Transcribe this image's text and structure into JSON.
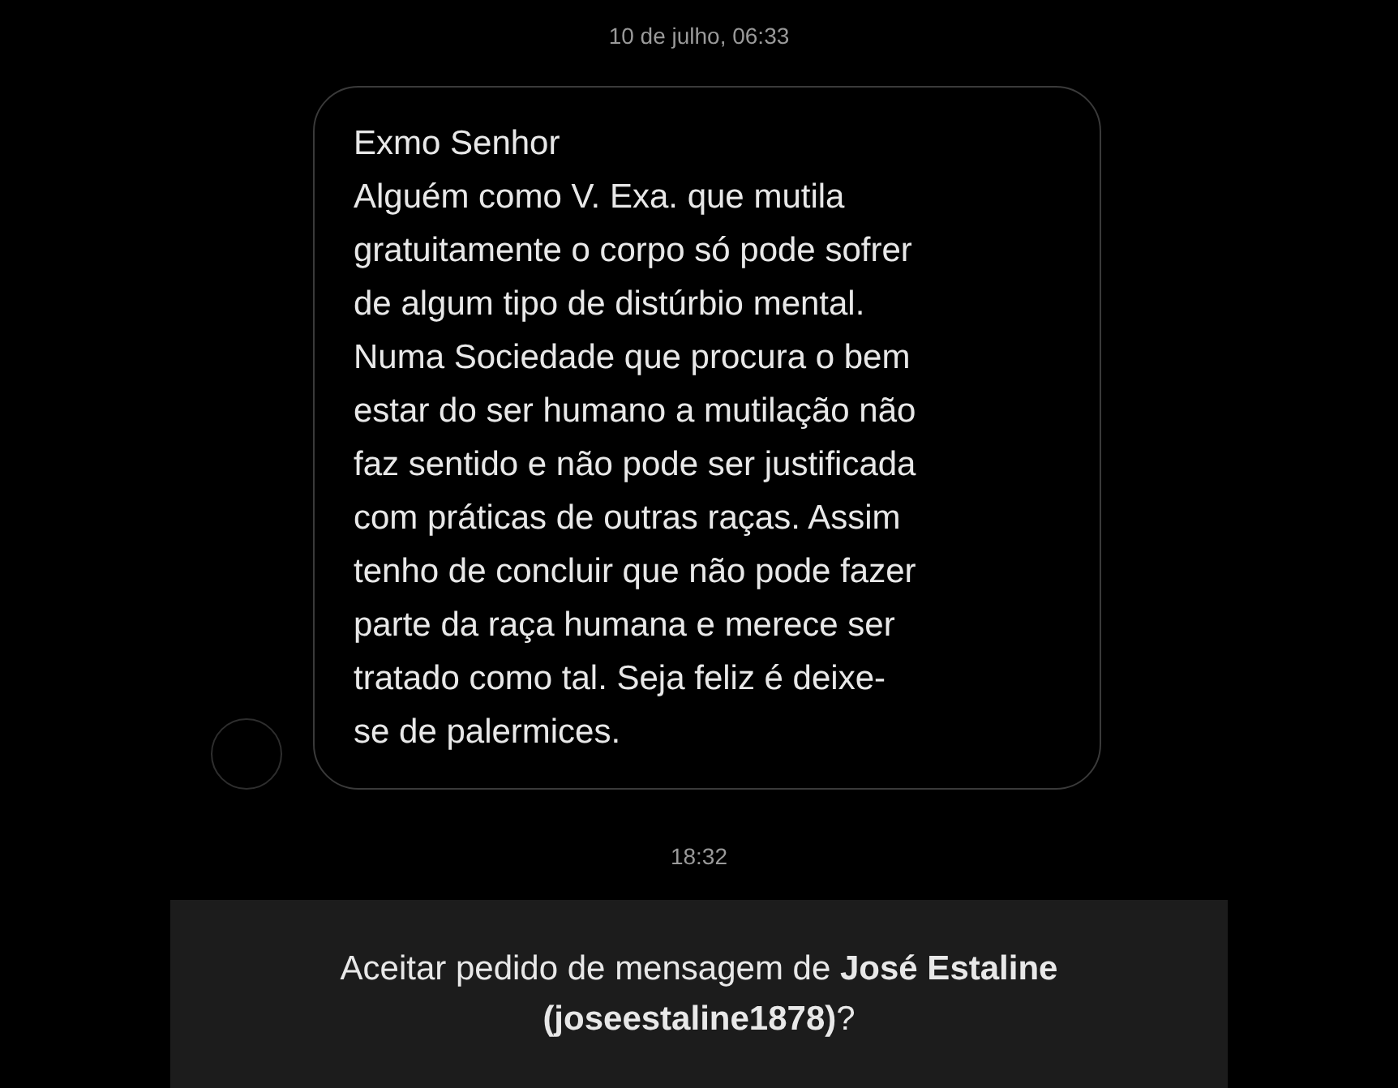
{
  "timestamp_top": "10 de julho, 06:33",
  "message": {
    "lines": [
      "Exmo Senhor",
      "Alguém como V. Exa. que mutila",
      "gratuitamente o corpo só pode sofrer",
      "de algum tipo de distúrbio mental.",
      "Numa Sociedade que procura o bem",
      "estar do ser humano a mutilação não",
      "faz sentido e não pode ser justificada",
      "com práticas de outras raças. Assim",
      "tenho de concluir que não pode fazer",
      "parte da raça humana e merece ser",
      "tratado como tal. Seja feliz é deixe-",
      "se de palermices."
    ]
  },
  "timestamp_bottom": "18:32",
  "request_prompt": "Aceitar pedido de mensagem de **José Estaline (joseestaline1878)**?"
}
